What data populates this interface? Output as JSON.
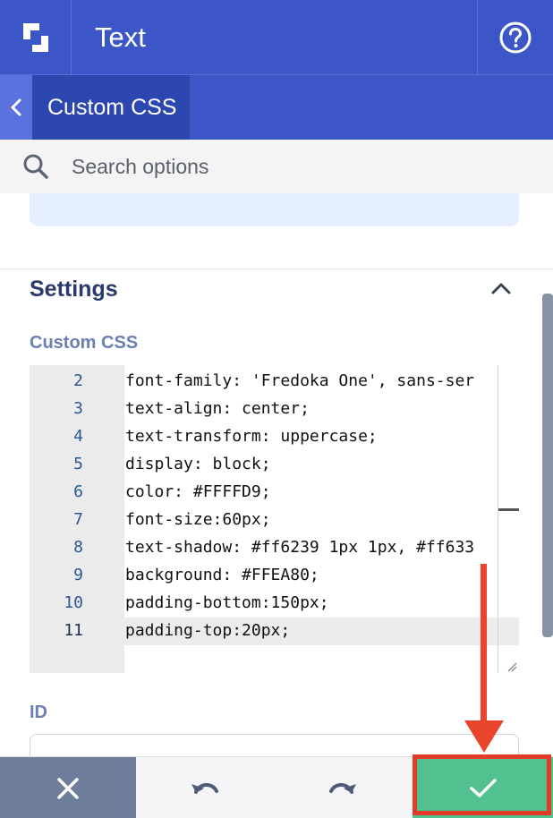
{
  "header": {
    "title": "Text",
    "logo_icon": "logo-icon",
    "help_icon": "help-icon"
  },
  "breadcrumb": {
    "back_icon": "chevron-left-icon",
    "label": "Custom CSS"
  },
  "search": {
    "placeholder": "Search options",
    "value": ""
  },
  "settings": {
    "title": "Settings",
    "custom_css_label": "Custom CSS",
    "id_label": "ID",
    "code_lines": [
      {
        "num": "2",
        "code": "font-family: 'Fredoka One', sans-ser"
      },
      {
        "num": "3",
        "code": "text-align: center;"
      },
      {
        "num": "4",
        "code": "text-transform: uppercase;"
      },
      {
        "num": "5",
        "code": "display: block;"
      },
      {
        "num": "6",
        "code": "color: #FFFFD9;"
      },
      {
        "num": "7",
        "code": "font-size:60px;"
      },
      {
        "num": "8",
        "code": "text-shadow: #ff6239 1px 1px, #ff633"
      },
      {
        "num": "9",
        "code": "background: #FFEA80;"
      },
      {
        "num": "10",
        "code": "padding-bottom:150px;"
      },
      {
        "num": "11",
        "code": "padding-top:20px;"
      }
    ],
    "active_line": 11,
    "id_value": ""
  },
  "toolbar": {
    "cancel_icon": "close-icon",
    "undo_icon": "undo-icon",
    "redo_icon": "redo-icon",
    "save_icon": "check-icon"
  },
  "colors": {
    "header": "#3c56c8",
    "breadcrumb_active": "#2d47b0",
    "save": "#53c08f",
    "cancel": "#6e7d99",
    "annotation": "#e8452c"
  }
}
